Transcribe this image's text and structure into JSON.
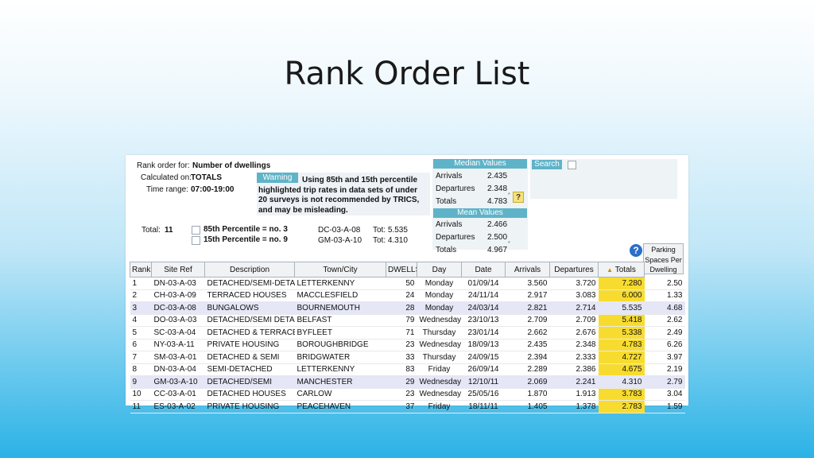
{
  "slide": {
    "title": "Rank Order List"
  },
  "info": {
    "rank_order_label": "Rank order for:",
    "rank_order_value": "Number of dwellings",
    "calculated_label": "Calculated on:",
    "calculated_value": "TOTALS",
    "time_label": "Time range:",
    "time_value": "07:00-19:00",
    "total_label": "Total:",
    "total_value": "11"
  },
  "warning": {
    "badge": "Warning",
    "line1": "Using 85th and 15th percentile",
    "line2": "highlighted trip rates in data sets of under",
    "line3": "20 surveys is not recommended by TRICS,",
    "line4": "and may be misleading."
  },
  "percentiles": {
    "p85": "85th Percentile = no. 3",
    "p15": "15th Percentile = no. 9",
    "p85_site": "DC-03-A-08",
    "p85_tot": "Tot: 5.535",
    "p15_site": "GM-03-A-10",
    "p15_tot": "Tot: 4.310"
  },
  "median": {
    "header": "Median Values",
    "rows": [
      {
        "label": "Arrivals",
        "value": "2.435"
      },
      {
        "label": "Departures",
        "value": "2.348"
      },
      {
        "label": "Totals",
        "value": "4.783"
      }
    ]
  },
  "mean": {
    "header": "Mean Values",
    "rows": [
      {
        "label": "Arrivals",
        "value": "2.466"
      },
      {
        "label": "Departures",
        "value": "2.500"
      },
      {
        "label": "Totals",
        "value": "4.967"
      }
    ]
  },
  "search": {
    "label": "Search"
  },
  "icons": {
    "help": "?",
    "question_box": "?",
    "star": "*"
  },
  "colors": {
    "badge": "#5fb3c8",
    "highlight_total": "#f7dc2f",
    "highlight_row": "#e5e6f6"
  },
  "table": {
    "headers": {
      "rank": "Rank",
      "site_ref": "Site Ref",
      "description": "Description",
      "town": "Town/City",
      "dwells": "DWELLS",
      "day": "Day",
      "date": "Date",
      "arrivals": "Arrivals",
      "departures": "Departures",
      "totals": "Totals",
      "parking1": "Parking",
      "parking2": "Spaces Per",
      "parking3": "Dwelling"
    },
    "rows": [
      {
        "rank": "1",
        "site": "DN-03-A-03",
        "desc": "DETACHED/SEMI-DETAC",
        "town": "LETTERKENNY",
        "dwells": "50",
        "day": "Monday",
        "date": "01/09/14",
        "arr": "3.560",
        "dep": "3.720",
        "tot": "7.280",
        "park": "2.50"
      },
      {
        "rank": "2",
        "site": "CH-03-A-09",
        "desc": "TERRACED HOUSES",
        "town": "MACCLESFIELD",
        "dwells": "24",
        "day": "Monday",
        "date": "24/11/14",
        "arr": "2.917",
        "dep": "3.083",
        "tot": "6.000",
        "park": "1.33"
      },
      {
        "rank": "3",
        "site": "DC-03-A-08",
        "desc": "BUNGALOWS",
        "town": "BOURNEMOUTH",
        "dwells": "28",
        "day": "Monday",
        "date": "24/03/14",
        "arr": "2.821",
        "dep": "2.714",
        "tot": "5.535",
        "park": "4.68"
      },
      {
        "rank": "4",
        "site": "DO-03-A-03",
        "desc": "DETACHED/SEMI DETAC",
        "town": "BELFAST",
        "dwells": "79",
        "day": "Wednesday",
        "date": "23/10/13",
        "arr": "2.709",
        "dep": "2.709",
        "tot": "5.418",
        "park": "2.62"
      },
      {
        "rank": "5",
        "site": "SC-03-A-04",
        "desc": "DETACHED & TERRACED",
        "town": "BYFLEET",
        "dwells": "71",
        "day": "Thursday",
        "date": "23/01/14",
        "arr": "2.662",
        "dep": "2.676",
        "tot": "5.338",
        "park": "2.49"
      },
      {
        "rank": "6",
        "site": "NY-03-A-11",
        "desc": "PRIVATE HOUSING",
        "town": "BOROUGHBRIDGE",
        "dwells": "23",
        "day": "Wednesday",
        "date": "18/09/13",
        "arr": "2.435",
        "dep": "2.348",
        "tot": "4.783",
        "park": "6.26"
      },
      {
        "rank": "7",
        "site": "SM-03-A-01",
        "desc": "DETACHED & SEMI",
        "town": "BRIDGWATER",
        "dwells": "33",
        "day": "Thursday",
        "date": "24/09/15",
        "arr": "2.394",
        "dep": "2.333",
        "tot": "4.727",
        "park": "3.97"
      },
      {
        "rank": "8",
        "site": "DN-03-A-04",
        "desc": "SEMI-DETACHED",
        "town": "LETTERKENNY",
        "dwells": "83",
        "day": "Friday",
        "date": "26/09/14",
        "arr": "2.289",
        "dep": "2.386",
        "tot": "4.675",
        "park": "2.19"
      },
      {
        "rank": "9",
        "site": "GM-03-A-10",
        "desc": "DETACHED/SEMI",
        "town": "MANCHESTER",
        "dwells": "29",
        "day": "Wednesday",
        "date": "12/10/11",
        "arr": "2.069",
        "dep": "2.241",
        "tot": "4.310",
        "park": "2.79"
      },
      {
        "rank": "10",
        "site": "CC-03-A-01",
        "desc": "DETACHED HOUSES",
        "town": "CARLOW",
        "dwells": "23",
        "day": "Wednesday",
        "date": "25/05/16",
        "arr": "1.870",
        "dep": "1.913",
        "tot": "3.783",
        "park": "3.04"
      },
      {
        "rank": "11",
        "site": "ES-03-A-02",
        "desc": "PRIVATE HOUSING",
        "town": "PEACEHAVEN",
        "dwells": "37",
        "day": "Friday",
        "date": "18/11/11",
        "arr": "1.405",
        "dep": "1.378",
        "tot": "2.783",
        "park": "1.59"
      }
    ]
  }
}
